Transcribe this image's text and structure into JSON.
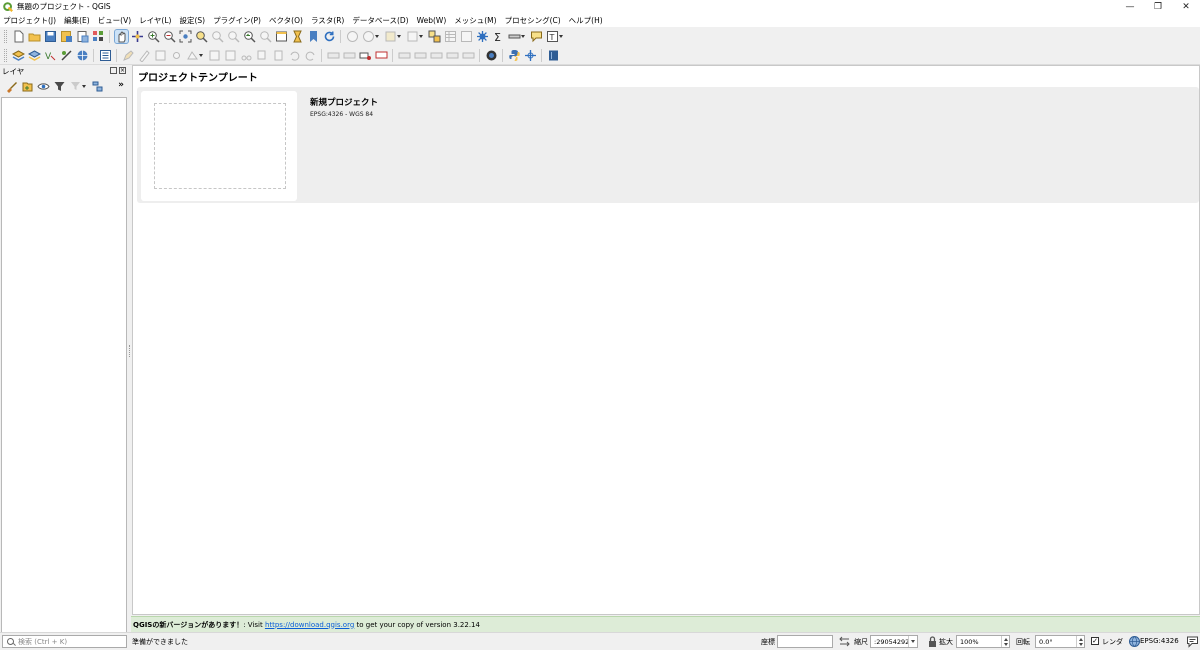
{
  "window": {
    "title": "無題のプロジェクト - QGIS",
    "minimize": "—",
    "restore": "❐",
    "close": "✕"
  },
  "menu": [
    "プロジェクト(J)",
    "編集(E)",
    "ビュー(V)",
    "レイヤ(L)",
    "設定(S)",
    "プラグイン(P)",
    "ベクタ(O)",
    "ラスタ(R)",
    "データベース(D)",
    "Web(W)",
    "メッシュ(M)",
    "プロセシング(C)",
    "ヘルプ(H)"
  ],
  "layers_panel": {
    "title": "レイヤ",
    "more": "»"
  },
  "main": {
    "page_title": "プロジェクトテンプレート",
    "template": {
      "name": "新規プロジェクト",
      "crs": "EPSG:4326 - WGS 84"
    }
  },
  "message_bar": {
    "bold": "QGISの新バージョンがあります！",
    "text1": ": Visit ",
    "link": "https://download.qgis.org",
    "text2": " to get your copy of version 3.22.14"
  },
  "status": {
    "search_placeholder": "検索 (Ctrl + K)",
    "ready": "準備ができました",
    "coordinate_label": "座標",
    "coordinate_value": "",
    "scale_label": "縮尺",
    "scale_value": ":29054292",
    "magnifier_label": "拡大",
    "magnifier_value": "100%",
    "rotation_label": "回転",
    "rotation_value": "0.0°",
    "render_label": "レンダ",
    "render_checked": "✓",
    "crs_label": "EPSG:4326"
  },
  "colors": {
    "accent": "#5a9c36",
    "message_bg": "#ddecd7",
    "link": "#0b5ed7"
  }
}
